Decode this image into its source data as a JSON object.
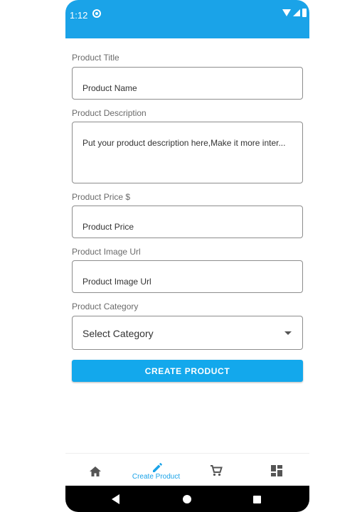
{
  "status_bar": {
    "time": "1:12",
    "color": "#1aa3e8"
  },
  "form": {
    "title_label": "Product Title",
    "title_placeholder": "Product Name",
    "description_label": "Product Description",
    "description_placeholder": "Put your product description here,Make it more inter...",
    "price_label": "Product Price $",
    "price_placeholder": "Product Price",
    "image_label": "Product Image Url",
    "image_placeholder": "Product Image Url",
    "category_label": "Product Category",
    "category_selected": "Select Category",
    "submit_label": "CREATE PRODUCT"
  },
  "bottom_nav": {
    "items": [
      {
        "icon": "home-icon",
        "label": ""
      },
      {
        "icon": "pencil-icon",
        "label": "Create Product",
        "active": true
      },
      {
        "icon": "cart-icon",
        "label": ""
      },
      {
        "icon": "dashboard-icon",
        "label": ""
      }
    ],
    "accent": "#1aa3e8"
  },
  "accent_color": "#13a8ec"
}
